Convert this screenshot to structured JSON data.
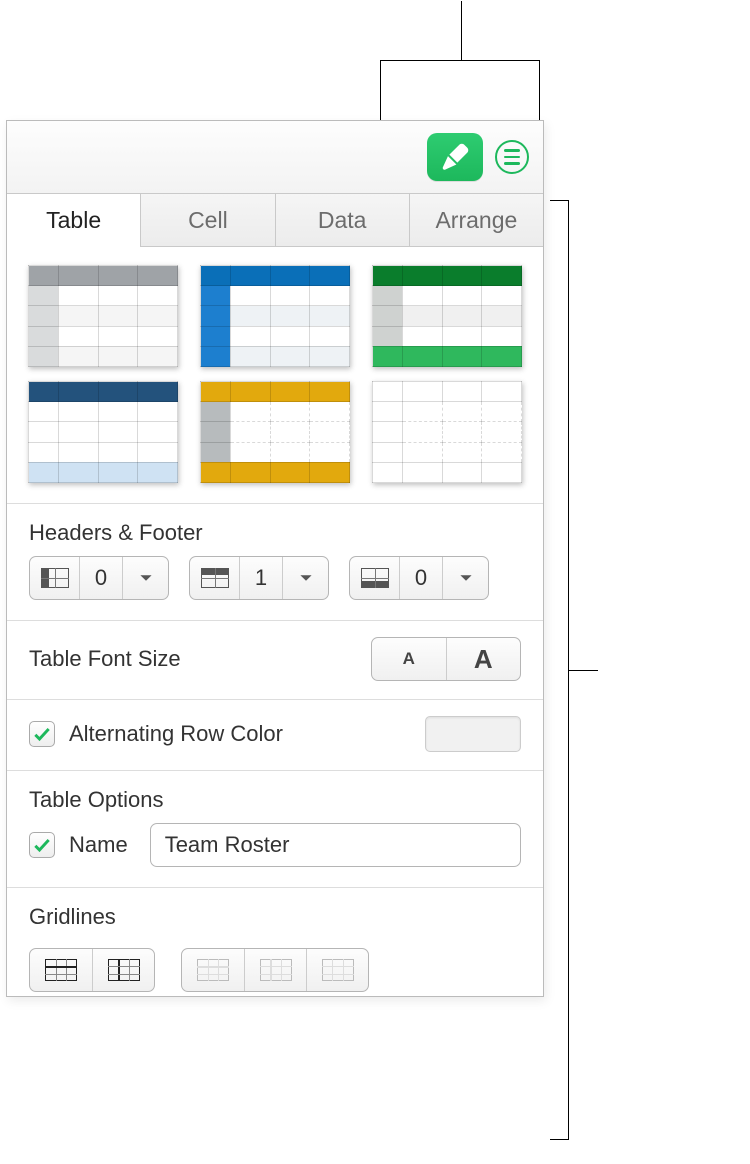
{
  "tabs": [
    {
      "label": "Table",
      "active": true
    },
    {
      "label": "Cell",
      "active": false
    },
    {
      "label": "Data",
      "active": false
    },
    {
      "label": "Arrange",
      "active": false
    }
  ],
  "headers_footer": {
    "title": "Headers & Footer",
    "columns_value": "0",
    "rows_value": "1",
    "footer_value": "0"
  },
  "font_size": {
    "title": "Table Font Size"
  },
  "alternating": {
    "label": "Alternating Row Color",
    "checked": true,
    "swatch_color": "#f1f1f1"
  },
  "table_options": {
    "title": "Table Options",
    "name_label": "Name",
    "name_checked": true,
    "name_value": "Team Roster"
  },
  "gridlines": {
    "title": "Gridlines"
  }
}
